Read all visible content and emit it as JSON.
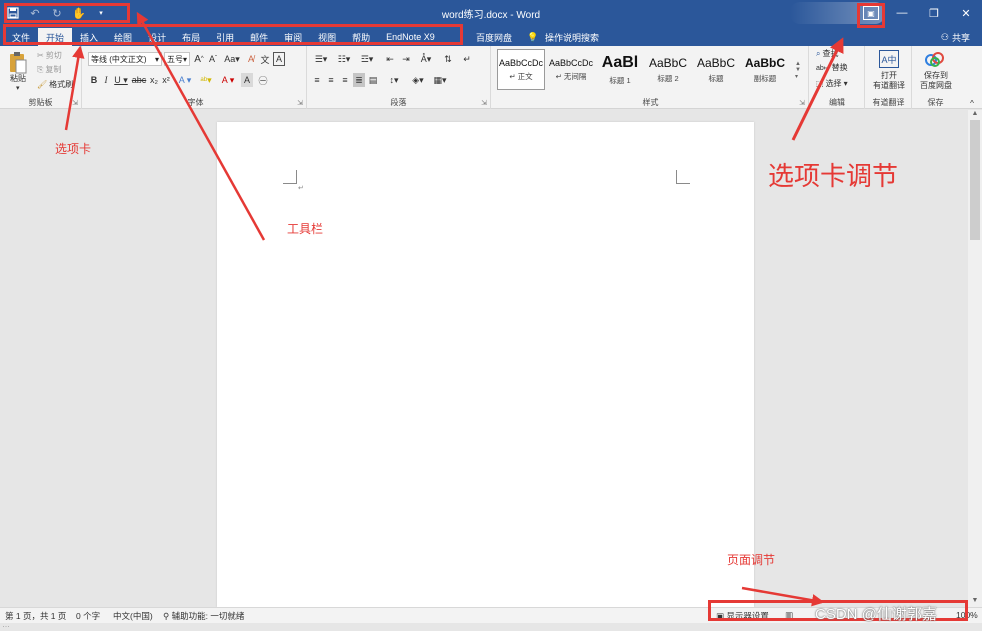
{
  "titlebar": {
    "title": "word练习.docx - Word",
    "share_label": "共享",
    "search_label": "操作说明搜索",
    "baidu_label": "百度网盘"
  },
  "tabs": [
    "文件",
    "开始",
    "插入",
    "绘图",
    "设计",
    "布局",
    "引用",
    "邮件",
    "审阅",
    "视图",
    "帮助",
    "EndNote X9"
  ],
  "active_tab": "开始",
  "ribbon": {
    "clipboard": {
      "label": "剪贴板",
      "paste": "粘贴",
      "cut": "剪切",
      "copy": "复制",
      "format_painter": "格式刷"
    },
    "font": {
      "label": "字体",
      "font_name": "等线 (中文正文)",
      "font_size": "五号"
    },
    "paragraph": {
      "label": "段落"
    },
    "styles": {
      "label": "样式",
      "items": [
        {
          "sample": "AaBbCcDc",
          "name": "↵ 正文"
        },
        {
          "sample": "AaBbCcDc",
          "name": "↵ 无间隔"
        },
        {
          "sample": "AaBl",
          "name": "标题 1"
        },
        {
          "sample": "AaBbC",
          "name": "标题 2"
        },
        {
          "sample": "AaBbC",
          "name": "标题"
        },
        {
          "sample": "AaBbC",
          "name": "副标题"
        }
      ]
    },
    "editing": {
      "label": "编辑",
      "find": "查找",
      "replace": "替换",
      "select": "选择"
    },
    "translate": {
      "label": "有道翻译",
      "button": "打开\n有道翻译"
    },
    "save": {
      "label": "保存",
      "button": "保存到\n百度网盘"
    }
  },
  "statusbar": {
    "page": "第 1 页，共 1 页",
    "words": "0 个字",
    "language": "中文(中国)",
    "accessibility": "辅助功能: 一切就绪",
    "display_settings": "显示器设置",
    "zoom": "100%"
  },
  "annotations": {
    "toolbar": "工具栏",
    "tabs": "选项卡",
    "tab_adjust": "选项卡调节",
    "page_adjust": "页面调节",
    "watermark": "CSDN @仙谢郭嘉"
  },
  "colors": {
    "accent": "#2b579a",
    "annotation": "#e53935"
  }
}
